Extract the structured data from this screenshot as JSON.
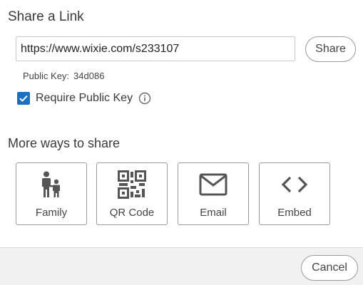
{
  "dialog": {
    "title": "Share a Link"
  },
  "link": {
    "url": "https://www.wixie.com/s233107",
    "share_label": "Share",
    "public_key_label": "Public Key:",
    "public_key_value": "34d086"
  },
  "require_public_key": {
    "label": "Require Public Key",
    "checked": true,
    "info_icon": "info-circle-icon"
  },
  "more_ways": {
    "title": "More ways to share",
    "options": [
      {
        "label": "Family",
        "icon": "family-icon"
      },
      {
        "label": "QR Code",
        "icon": "qr-code-icon"
      },
      {
        "label": "Email",
        "icon": "email-icon"
      },
      {
        "label": "Embed",
        "icon": "code-icon"
      }
    ]
  },
  "footer": {
    "cancel_label": "Cancel"
  },
  "colors": {
    "checkbox_accent": "#1f6fbf",
    "footer_background": "#f1f1f1"
  }
}
